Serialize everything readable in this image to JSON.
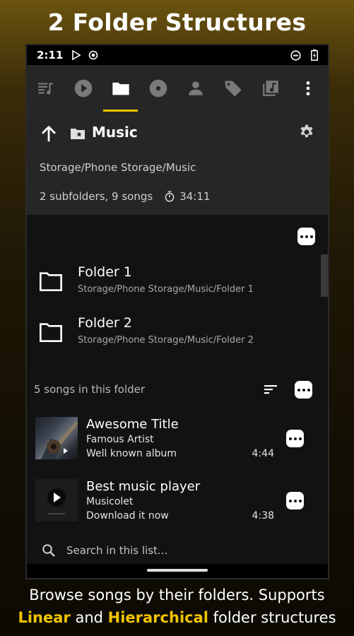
{
  "promo": {
    "title": "2 Folder Structures",
    "caption_line1": "Browse songs by their folders. Supports",
    "caption_hl1": "Linear",
    "caption_and": " and ",
    "caption_hl2": "Hierarchical",
    "caption_end": " folder structures"
  },
  "status_bar": {
    "time": "2:11",
    "icons_left": [
      "play-store-icon",
      "record-icon"
    ],
    "icons_right": [
      "do-not-disturb-icon",
      "battery-charging-icon"
    ]
  },
  "tabs": [
    {
      "name": "queue",
      "icon": "queue-icon",
      "active": false
    },
    {
      "name": "now-playing",
      "icon": "play-circle-icon",
      "active": false
    },
    {
      "name": "folders",
      "icon": "folder-icon",
      "active": true
    },
    {
      "name": "albums",
      "icon": "album-icon",
      "active": false
    },
    {
      "name": "artists",
      "icon": "person-icon",
      "active": false
    },
    {
      "name": "genres",
      "icon": "tag-icon",
      "active": false
    },
    {
      "name": "playlists",
      "icon": "playlist-icon",
      "active": false
    },
    {
      "name": "overflow",
      "icon": "more-vert-icon",
      "active": false
    }
  ],
  "header": {
    "folder_name": "Music",
    "path": "Storage/Phone Storage/Music",
    "summary": "2 subfolders, 9 songs",
    "duration": "34:11"
  },
  "folders": [
    {
      "name": "Folder 1",
      "path": "Storage/Phone Storage/Music/Folder 1"
    },
    {
      "name": "Folder 2",
      "path": "Storage/Phone Storage/Music/Folder 2"
    }
  ],
  "songs_section": {
    "count_label": "5 songs in this folder"
  },
  "songs": [
    {
      "title": "Awesome Title",
      "artist": "Famous Artist",
      "album": "Well known album",
      "duration": "4:44"
    },
    {
      "title": "Best music player",
      "artist": "Musicolet",
      "album": "Download it now",
      "duration": "4:38"
    }
  ],
  "search": {
    "placeholder": "Search in this list..."
  },
  "colors": {
    "accent": "#f2c400",
    "surface": "#262626",
    "background": "#121212"
  }
}
